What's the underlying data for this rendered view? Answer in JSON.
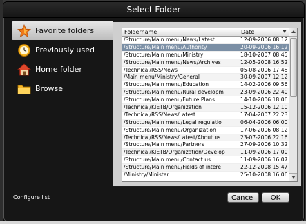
{
  "dialog": {
    "title": "Select Folder"
  },
  "sidebar": {
    "items": [
      {
        "label": "Favorite folders",
        "icon": "star-icon",
        "selected": true
      },
      {
        "label": "Previously used",
        "icon": "clock-icon",
        "selected": false
      },
      {
        "label": "Home folder",
        "icon": "home-icon",
        "selected": false
      },
      {
        "label": "Browse",
        "icon": "folder-icon",
        "selected": false
      }
    ],
    "configure_label": "Configure list"
  },
  "list": {
    "headers": {
      "name": "Foldername",
      "date": "Date"
    },
    "sort": "date-descending",
    "rows": [
      {
        "name": "/Structure/Main menu/News/Latest",
        "date": "12-09-2006 08:12"
      },
      {
        "name": "/Structure/Main menu/Authority",
        "date": "20-09-2006 16:12",
        "selected": true
      },
      {
        "name": "/Structure/Main menu/Ministry",
        "date": "18-10-2007 08:45"
      },
      {
        "name": "/Structure/Main menu/News/Archives",
        "date": "12-05-2008 16:52"
      },
      {
        "name": "/Technical/RSS/News",
        "date": "05-08-2006 17:48"
      },
      {
        "name": "/Main menu/Ministry/General",
        "date": "30-09-2007 12:12"
      },
      {
        "name": "/Structure/Main menu/Education",
        "date": "14-02-2006 09:56"
      },
      {
        "name": "/Structure/Main menu/Rural developm",
        "date": "23-09-2006 22:40"
      },
      {
        "name": "/Structure/Main menu/Future Plans",
        "date": "14-10-2006 18:06"
      },
      {
        "name": "/Technical/KIETB/Organization",
        "date": "15-12-2006 12:10"
      },
      {
        "name": "/Technical/RSS/News/Latest",
        "date": "17-04-2007 22:23"
      },
      {
        "name": "/Structure/Main menu/Legal regulatio",
        "date": "06-04-2006 06:00"
      },
      {
        "name": "/Structure/Main menu/Organization",
        "date": "17-06-2006 08:12"
      },
      {
        "name": "/Technical/RSS/News/Latest/About us",
        "date": "23-07-2006 22:16"
      },
      {
        "name": "/Structure/Main menu/Partners",
        "date": "27-09-2006 10:32"
      },
      {
        "name": "/Technical/KIETB/Organization/Develop",
        "date": "11-09-2006 17:00"
      },
      {
        "name": "/Structure/Main menu/Contact us",
        "date": "11-09-2006 16:07"
      },
      {
        "name": "/Structure/Main menu/Fields of intere",
        "date": "22-12-2008 15:47"
      },
      {
        "name": "/Ministry/Minister",
        "date": "25-10-2008 16:06"
      }
    ]
  },
  "buttons": {
    "cancel": "Cancel",
    "ok": "OK"
  },
  "colors": {
    "dialog_bg": "#161616",
    "panel_bg": "#cfcfcf",
    "selected_row": "#7b8fa5",
    "sidebar_selected": "#d6d6d6"
  }
}
